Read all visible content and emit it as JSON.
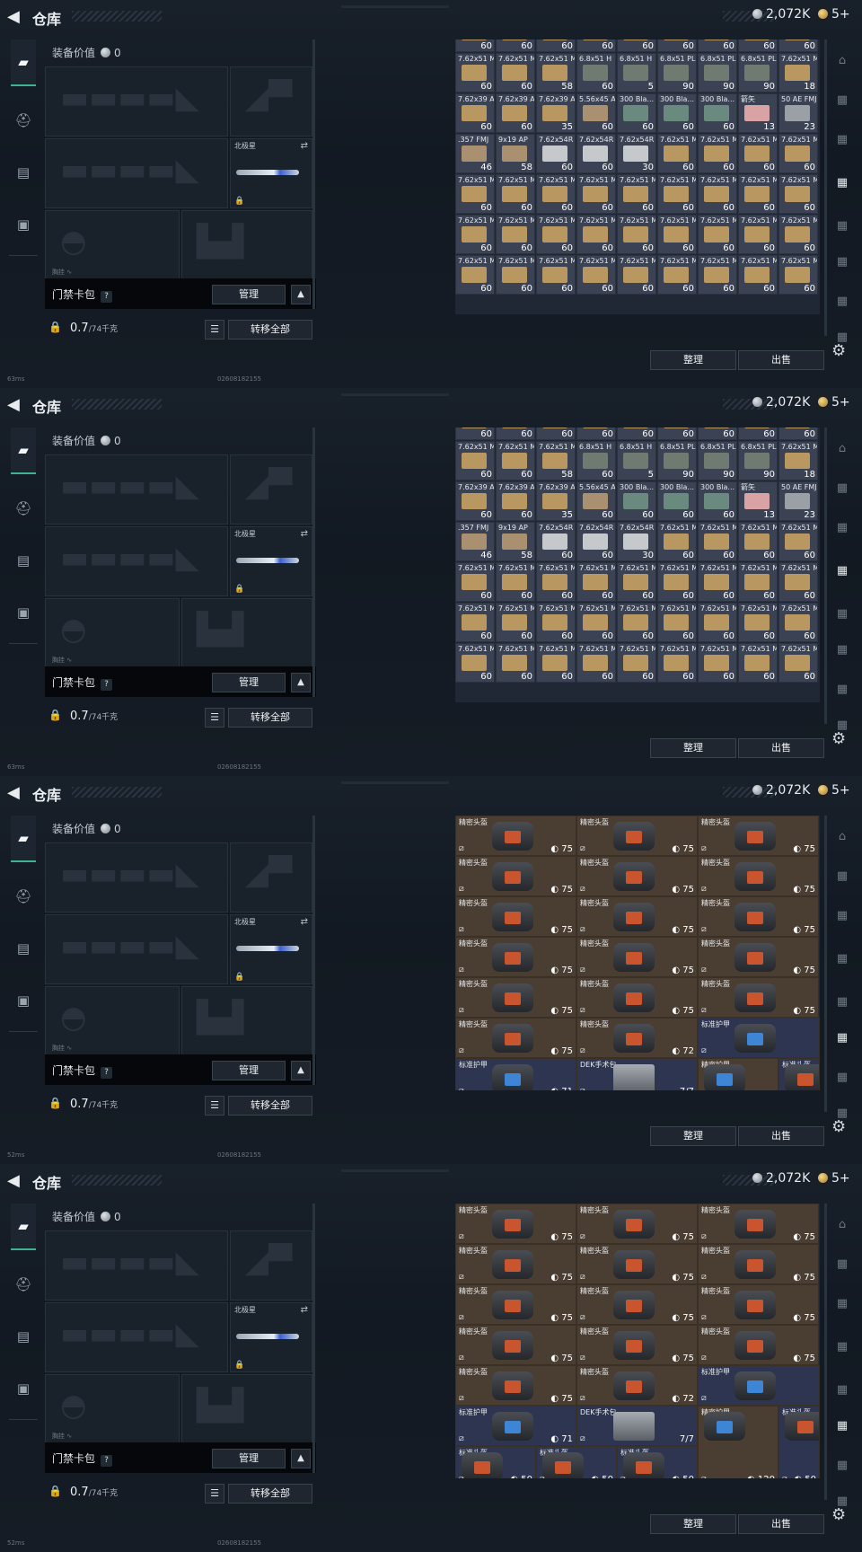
{
  "header": {
    "title": "仓库",
    "currency_silver": "2,072K",
    "currency_gold": "5+"
  },
  "equipment": {
    "value_label": "装备价值",
    "value": "0",
    "knife_label": "北极星",
    "section_hint": "胸挂 ∿",
    "card_pack_label": "门禁卡包",
    "help": "?",
    "manage_button": "管理",
    "collapse_icon": "chevron-up-icon",
    "weight_value": "0.7",
    "weight_max": "/74千克",
    "transfer_all_button": "转移全部"
  },
  "actions": {
    "sort_button": "整理",
    "sell_button": "出售"
  },
  "frames": [
    {
      "status": "63ms",
      "uid": "02608182155"
    },
    {
      "status": "63ms",
      "uid": "02608182155"
    },
    {
      "status": "52ms",
      "uid": "02608182155"
    },
    {
      "status": "52ms",
      "uid": "02608182155"
    }
  ],
  "ammo_grid": {
    "rows": [
      [
        {
          "n": "",
          "q": "60"
        },
        {
          "n": "",
          "q": "60"
        },
        {
          "n": "",
          "q": "60"
        },
        {
          "n": "",
          "q": "60"
        },
        {
          "n": "",
          "q": "60"
        },
        {
          "n": "",
          "q": "60"
        },
        {
          "n": "",
          "q": "60"
        },
        {
          "n": "",
          "q": "60"
        },
        {
          "n": "",
          "q": "60"
        }
      ],
      [
        {
          "n": "7.62x51 M",
          "q": "60"
        },
        {
          "n": "7.62x51 M",
          "q": "60"
        },
        {
          "n": "7.62x51 M",
          "q": "58"
        },
        {
          "n": "6.8x51 H",
          "q": "60"
        },
        {
          "n": "6.8x51 H",
          "q": "5"
        },
        {
          "n": "6.8x51 PL",
          "q": "90"
        },
        {
          "n": "6.8x51 PL",
          "q": "90"
        },
        {
          "n": "6.8x51 PL",
          "q": "90"
        },
        {
          "n": "7.62x51 M",
          "q": "18"
        }
      ],
      [
        {
          "n": "7.62x39 AP",
          "q": "60"
        },
        {
          "n": "7.62x39 AP",
          "q": "60"
        },
        {
          "n": "7.62x39 AP",
          "q": "35"
        },
        {
          "n": "5.56x45 AP",
          "q": "60"
        },
        {
          "n": "300 Bla... BCP FMJ",
          "q": "60"
        },
        {
          "n": "300 Bla... BCP FMJ",
          "q": "60"
        },
        {
          "n": "300 Bla... BCP FMJ",
          "q": "60"
        },
        {
          "n": "箭矢",
          "q": "13"
        },
        {
          "n": "50 AE FMJ",
          "q": "23"
        }
      ],
      [
        {
          "n": ".357 FMJ",
          "q": "46"
        },
        {
          "n": "9x19 AP",
          "q": "58"
        },
        {
          "n": "7.62x54R LPS",
          "q": "60"
        },
        {
          "n": "7.62x54R LPS",
          "q": "60"
        },
        {
          "n": "7.62x54R LPS",
          "q": "30"
        },
        {
          "n": "7.62x51 M",
          "q": "60"
        },
        {
          "n": "7.62x51 M",
          "q": "60"
        },
        {
          "n": "7.62x51 M",
          "q": "60"
        },
        {
          "n": "7.62x51 M",
          "q": "60"
        }
      ],
      [
        {
          "n": "7.62x51 M",
          "q": "60"
        },
        {
          "n": "7.62x51 M",
          "q": "60"
        },
        {
          "n": "7.62x51 M",
          "q": "60"
        },
        {
          "n": "7.62x51 M",
          "q": "60"
        },
        {
          "n": "7.62x51 M",
          "q": "60"
        },
        {
          "n": "7.62x51 M",
          "q": "60"
        },
        {
          "n": "7.62x51 M",
          "q": "60"
        },
        {
          "n": "7.62x51 M",
          "q": "60"
        },
        {
          "n": "7.62x51 M",
          "q": "60"
        }
      ],
      [
        {
          "n": "7.62x51 M",
          "q": "60"
        },
        {
          "n": "7.62x51 M",
          "q": "60"
        },
        {
          "n": "7.62x51 M",
          "q": "60"
        },
        {
          "n": "7.62x51 M",
          "q": "60"
        },
        {
          "n": "7.62x51 M",
          "q": "60"
        },
        {
          "n": "7.62x51 M",
          "q": "60"
        },
        {
          "n": "7.62x51 M",
          "q": "60"
        },
        {
          "n": "7.62x51 M",
          "q": "60"
        },
        {
          "n": "7.62x51 M",
          "q": "60"
        }
      ],
      [
        {
          "n": "7.62x51 M",
          "q": "60"
        },
        {
          "n": "7.62x51 M",
          "q": "60"
        },
        {
          "n": "7.62x51 M",
          "q": "60"
        },
        {
          "n": "7.62x51 M",
          "q": "60"
        },
        {
          "n": "7.62x51 M",
          "q": "60"
        },
        {
          "n": "7.62x51 M",
          "q": "60"
        },
        {
          "n": "7.62x51 M",
          "q": "60"
        },
        {
          "n": "7.62x51 M",
          "q": "60"
        },
        {
          "n": "7.62x51 M",
          "q": "60"
        }
      ]
    ]
  },
  "gear_grid": {
    "helmet_name": "精密头盔",
    "armor_name": "标准护甲",
    "std_helmet_name": "标准头盔",
    "kit_name": "DEK手术包",
    "fine_armor_name": "精密护甲",
    "dur_75": "75",
    "dur_72": "72",
    "dur_71": "71",
    "kit_qty": "7/7",
    "dur_120": "120",
    "dur_50": "50"
  }
}
